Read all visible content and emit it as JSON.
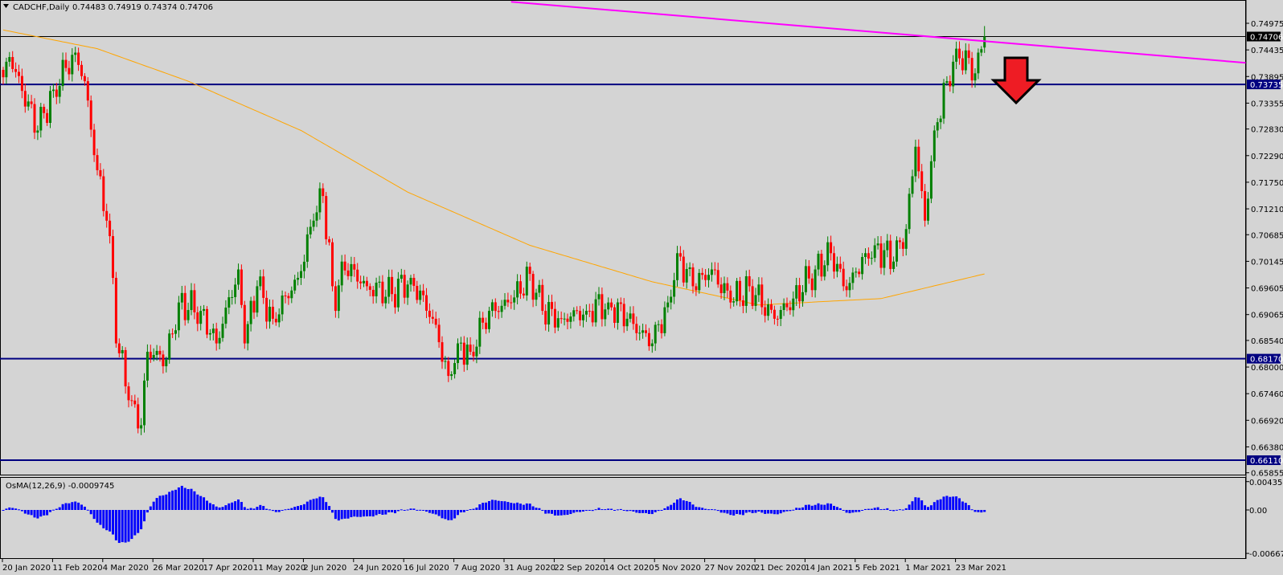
{
  "header": {
    "symbol_label": "CADCHF,Daily",
    "ohlc": "0.74483 0.74919 0.74374 0.74706"
  },
  "indicator": {
    "label": "OsMA(12,26,9) -0.0009745",
    "ticks": [
      "0.0043562",
      "0.00",
      "-0.006679"
    ],
    "tick_values": [
      0.0043562,
      0,
      -0.006679
    ]
  },
  "colors": {
    "background": "#d4d4d4",
    "bull": "#008000",
    "bear": "#ff0000",
    "ma": "#ffa500",
    "trendline": "#ff00ff",
    "level": "#000080",
    "osma": "#0000ff",
    "arrow": "#ee1c24"
  },
  "chart_data": {
    "type": "candlestick",
    "title": "CADCHF,Daily",
    "price_ticks": [
      "0.74975",
      "0.74435",
      "0.73895",
      "0.73355",
      "0.72830",
      "0.72290",
      "0.71750",
      "0.71210",
      "0.70685",
      "0.70145",
      "0.69605",
      "0.69065",
      "0.68540",
      "0.68000",
      "0.67460",
      "0.66920",
      "0.66380",
      "0.65855"
    ],
    "ylim": [
      0.65855,
      0.74975
    ],
    "date_labels": [
      "20 Jan 2020",
      "11 Feb 2020",
      "4 Mar 2020",
      "26 Mar 2020",
      "17 Apr 2020",
      "11 May 2020",
      "2 Jun 2020",
      "24 Jun 2020",
      "16 Jul 2020",
      "7 Aug 2020",
      "31 Aug 2020",
      "22 Sep 2020",
      "14 Oct 2020",
      "5 Nov 2020",
      "27 Nov 2020",
      "21 Dec 2020",
      "14 Jan 2021",
      "5 Feb 2021",
      "1 Mar 2021",
      "23 Mar 2021"
    ],
    "bars_per_date_label": 16,
    "close_path": [
      [
        0,
        0.7388
      ],
      [
        2,
        0.7429
      ],
      [
        11,
        0.728
      ],
      [
        16,
        0.7363
      ],
      [
        23,
        0.7438
      ],
      [
        26,
        0.738
      ],
      [
        29,
        0.723
      ],
      [
        33,
        0.7097
      ],
      [
        35,
        0.6981
      ],
      [
        36,
        0.6848
      ],
      [
        41,
        0.6732
      ],
      [
        44,
        0.6682
      ],
      [
        46,
        0.6831
      ],
      [
        52,
        0.6815
      ],
      [
        56,
        0.6931
      ],
      [
        63,
        0.6914
      ],
      [
        68,
        0.6848
      ],
      [
        75,
        0.6998
      ],
      [
        77,
        0.6848
      ],
      [
        81,
        0.6964
      ],
      [
        86,
        0.6898
      ],
      [
        94,
        0.6981
      ],
      [
        99,
        0.7097
      ],
      [
        102,
        0.7147
      ],
      [
        105,
        0.6964
      ],
      [
        106,
        0.6914
      ],
      [
        108,
        0.7014
      ],
      [
        116,
        0.6964
      ],
      [
        124,
        0.6948
      ],
      [
        130,
        0.6981
      ],
      [
        137,
        0.6898
      ],
      [
        142,
        0.6782
      ],
      [
        145,
        0.6848
      ],
      [
        149,
        0.6831
      ],
      [
        155,
        0.6914
      ],
      [
        162,
        0.6931
      ],
      [
        168,
        0.6989
      ],
      [
        172,
        0.6914
      ],
      [
        178,
        0.6898
      ],
      [
        186,
        0.6914
      ],
      [
        193,
        0.6931
      ],
      [
        199,
        0.6898
      ],
      [
        207,
        0.6848
      ],
      [
        212,
        0.6931
      ],
      [
        215,
        0.7031
      ],
      [
        220,
        0.6964
      ],
      [
        226,
        0.6998
      ],
      [
        232,
        0.6931
      ],
      [
        238,
        0.6964
      ],
      [
        246,
        0.6898
      ],
      [
        252,
        0.6939
      ],
      [
        259,
        0.6998
      ],
      [
        264,
        0.7031
      ],
      [
        269,
        0.6956
      ],
      [
        275,
        0.7031
      ],
      [
        278,
        0.7047
      ],
      [
        284,
        0.7014
      ],
      [
        288,
        0.708
      ],
      [
        291,
        0.7247
      ],
      [
        294,
        0.7097
      ],
      [
        297,
        0.728
      ],
      [
        301,
        0.738
      ],
      [
        304,
        0.7446
      ],
      [
        310,
        0.7396
      ],
      [
        313,
        0.74706
      ]
    ],
    "last_bar": {
      "open": 0.74483,
      "high": 0.74919,
      "low": 0.74374,
      "close": 0.74706
    },
    "moving_average": [
      [
        0,
        0.7484
      ],
      [
        30,
        0.7446
      ],
      [
        59,
        0.738
      ],
      [
        95,
        0.728
      ],
      [
        129,
        0.7155
      ],
      [
        168,
        0.7047
      ],
      [
        207,
        0.6973
      ],
      [
        241,
        0.6926
      ],
      [
        280,
        0.6939
      ],
      [
        313,
        0.6989
      ]
    ],
    "trendline": [
      [
        162,
        0.7541
      ],
      [
        395,
        0.7418
      ]
    ],
    "levels": [
      {
        "price": 0.74706,
        "label": "0.74706",
        "kind": "current"
      },
      {
        "price": 0.73735,
        "label": "0.73735",
        "kind": "level"
      },
      {
        "price": 0.6817,
        "label": "0.68170",
        "kind": "level"
      },
      {
        "price": 0.6611,
        "label": "0.66110",
        "kind": "level"
      }
    ],
    "annotation": "down-arrow"
  }
}
